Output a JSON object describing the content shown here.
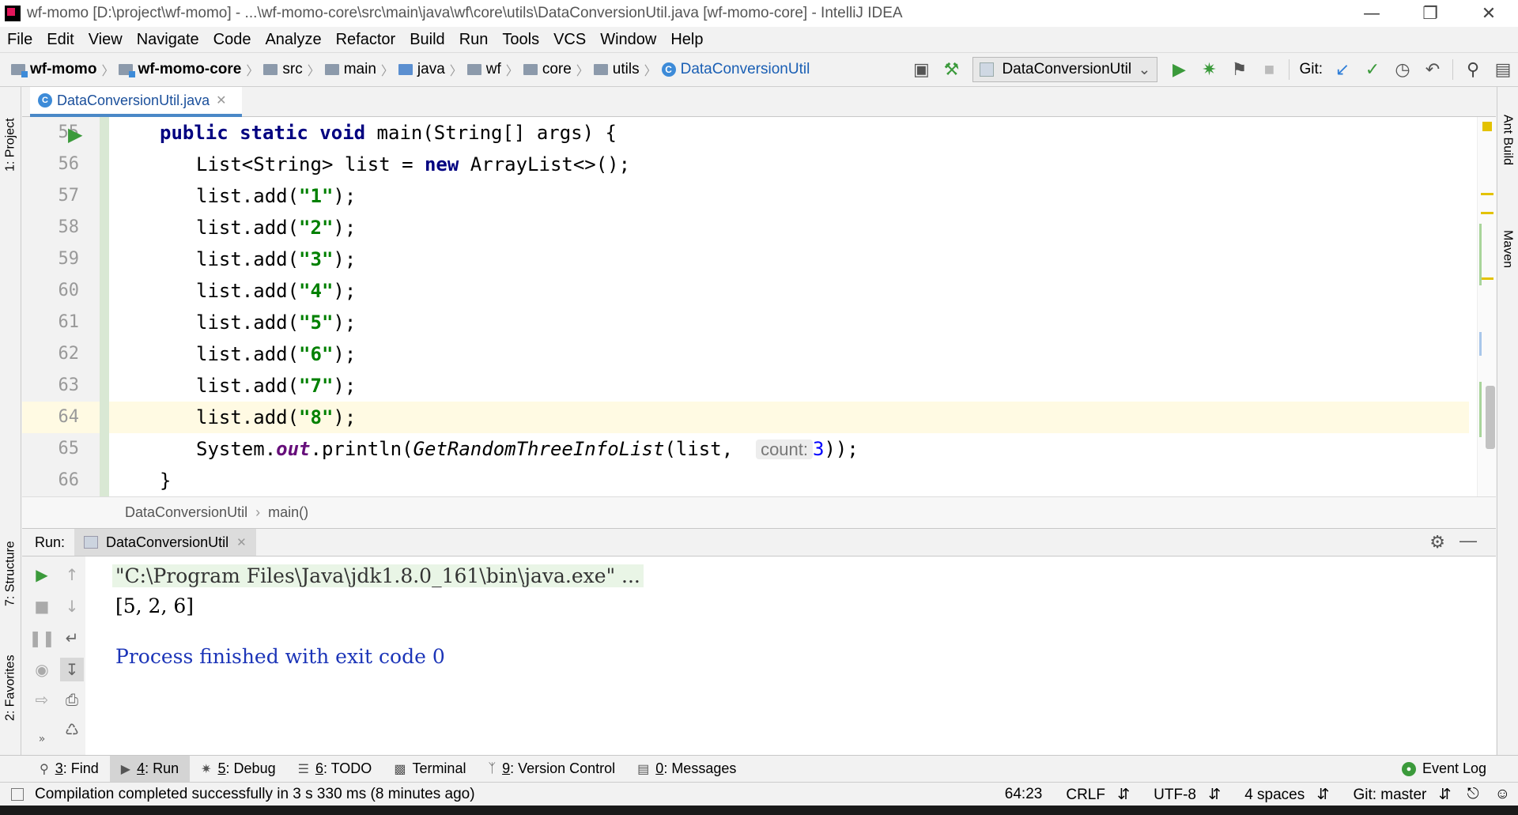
{
  "window": {
    "title": "wf-momo [D:\\project\\wf-momo] - ...\\wf-momo-core\\src\\main\\java\\wf\\core\\utils\\DataConversionUtil.java [wf-momo-core] - IntelliJ IDEA"
  },
  "menu": [
    "File",
    "Edit",
    "View",
    "Navigate",
    "Code",
    "Analyze",
    "Refactor",
    "Build",
    "Run",
    "Tools",
    "VCS",
    "Window",
    "Help"
  ],
  "breadcrumbs": [
    "wf-momo",
    "wf-momo-core",
    "src",
    "main",
    "java",
    "wf",
    "core",
    "utils",
    "DataConversionUtil"
  ],
  "toolbar": {
    "run_config": "DataConversionUtil",
    "git_label": "Git:"
  },
  "side_tabs": {
    "project": "1: Project",
    "structure": "7: Structure",
    "favorites": "2: Favorites",
    "ant_build": "Ant Build",
    "maven": "Maven"
  },
  "editor": {
    "tab_label": "DataConversionUtil.java",
    "line_numbers": [
      "55",
      "56",
      "57",
      "58",
      "59",
      "60",
      "61",
      "62",
      "63",
      "64",
      "65",
      "66"
    ],
    "current_line": "64",
    "code": {
      "l55_kw": "public static void",
      "l55_rest": " main(String[] args) {",
      "l56_a": "List<String> list = ",
      "l56_kw": "new",
      "l56_b": " ArrayList<>();",
      "add_prefix": "list.add(",
      "add_suffix": ");",
      "adds": [
        "\"1\"",
        "\"2\"",
        "\"3\"",
        "\"4\"",
        "\"5\"",
        "\"6\"",
        "\"7\"",
        "\"8\""
      ],
      "l65_a": "System.",
      "l65_out": "out",
      "l65_b": ".println(",
      "l65_call": "GetRandomThreeInfoList",
      "l65_c": "(list, ",
      "l65_hint": "count:",
      "l65_num": "3",
      "l65_d": "));",
      "l66": "}"
    },
    "breadcrumb": [
      "DataConversionUtil",
      "main()"
    ]
  },
  "run_panel": {
    "label": "Run:",
    "tab": "DataConversionUtil",
    "console": [
      "\"C:\\Program Files\\Java\\jdk1.8.0_161\\bin\\java.exe\" ...",
      "[5, 2, 6]",
      "",
      "Process finished with exit code 0"
    ]
  },
  "bottom_tabs": [
    {
      "num": "3",
      "label": ": Find"
    },
    {
      "num": "4",
      "label": ": Run"
    },
    {
      "num": "5",
      "label": ": Debug"
    },
    {
      "num": "6",
      "label": ": TODO"
    },
    {
      "num": "",
      "label": "Terminal"
    },
    {
      "num": "9",
      "label": ": Version Control"
    },
    {
      "num": "0",
      "label": ": Messages"
    }
  ],
  "event_log": "Event Log",
  "status": {
    "message": "Compilation completed successfully in 3 s 330 ms (8 minutes ago)",
    "position": "64:23",
    "line_sep": "CRLF",
    "encoding": "UTF-8",
    "indent": "4 spaces",
    "git": "Git: master"
  },
  "colors": {
    "keyword": "#000080",
    "string": "#008000",
    "number": "#0000ff",
    "field": "#660e7a",
    "console_blue": "#1c35b8"
  }
}
